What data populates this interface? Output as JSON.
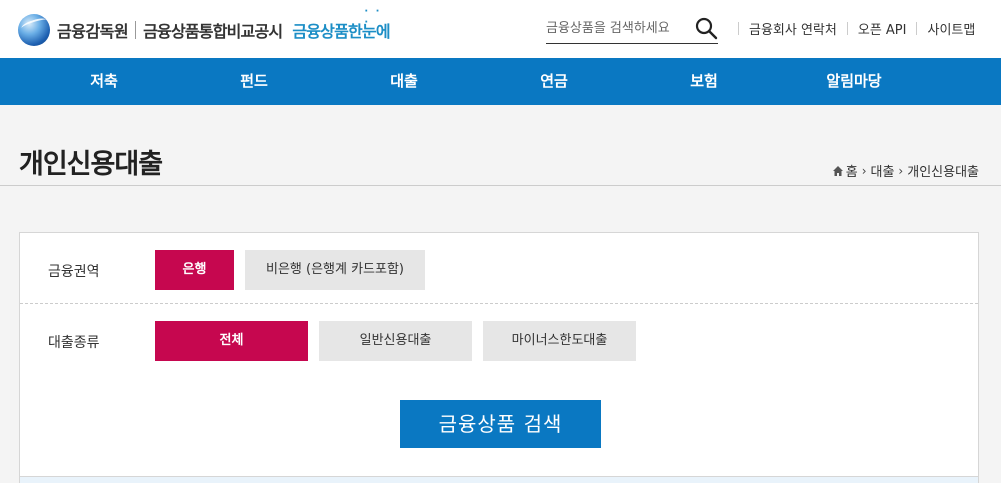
{
  "header": {
    "org_name": "금융감독원",
    "site_name": "금융상품통합비교공시",
    "brand_name": "금융상품한눈에",
    "search_placeholder": "금융상품을 검색하세요",
    "utility_links": [
      "금융회사 연락처",
      "오픈 API",
      "사이트맵"
    ]
  },
  "nav": {
    "items": [
      "저축",
      "펀드",
      "대출",
      "연금",
      "보험",
      "알림마당"
    ]
  },
  "page": {
    "title": "개인신용대출",
    "breadcrumb": [
      "홈",
      "대출",
      "개인신용대출"
    ]
  },
  "filters": {
    "sector": {
      "label": "금융권역",
      "options": [
        "은행",
        "비은행 (은행계 카드포함)"
      ],
      "selected": "은행"
    },
    "loan_type": {
      "label": "대출종류",
      "options": [
        "전체",
        "일반신용대출",
        "마이너스한도대출"
      ],
      "selected": "전체"
    },
    "search_button": "금융상품 검색"
  },
  "colors": {
    "primary_blue": "#0a78c2",
    "active_magenta": "#c6074f",
    "inactive_gray": "#e6e6e6"
  }
}
